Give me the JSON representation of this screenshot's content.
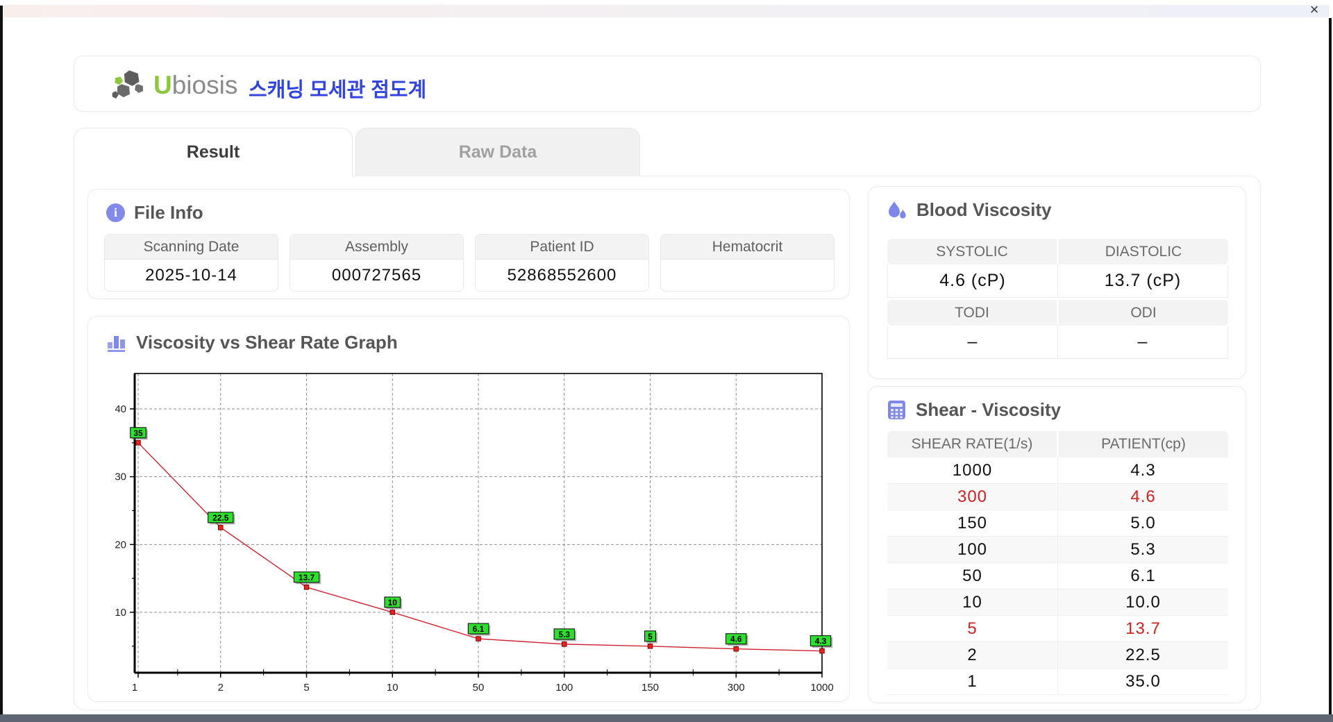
{
  "window": {
    "close_label": "×"
  },
  "header": {
    "logo_u": "U",
    "logo_rest": "biosis",
    "app_title_ko": "스캐닝 모세관 점도계"
  },
  "tabs": [
    {
      "label": "Result",
      "active": true
    },
    {
      "label": "Raw Data",
      "active": false
    }
  ],
  "file_info": {
    "title": "File Info",
    "fields": [
      {
        "label": "Scanning Date",
        "value": "2025-10-14"
      },
      {
        "label": "Assembly",
        "value": "000727565"
      },
      {
        "label": "Patient ID",
        "value": "52868552600"
      },
      {
        "label": "Hematocrit",
        "value": ""
      }
    ]
  },
  "blood_viscosity": {
    "title": "Blood Viscosity",
    "groups": [
      {
        "cells": [
          {
            "label": "SYSTOLIC",
            "value": "4.6 (cP)"
          },
          {
            "label": "DIASTOLIC",
            "value": "13.7 (cP)"
          }
        ]
      },
      {
        "cells": [
          {
            "label": "TODI",
            "value": "–"
          },
          {
            "label": "ODI",
            "value": "–"
          }
        ]
      }
    ]
  },
  "shear_viscosity": {
    "title": "Shear - Viscosity",
    "columns": [
      "SHEAR RATE(1/s)",
      "PATIENT(cp)"
    ],
    "rows": [
      {
        "shear": "1000",
        "patient": "4.3",
        "highlight": false
      },
      {
        "shear": "300",
        "patient": "4.6",
        "highlight": true
      },
      {
        "shear": "150",
        "patient": "5.0",
        "highlight": false
      },
      {
        "shear": "100",
        "patient": "5.3",
        "highlight": false
      },
      {
        "shear": "50",
        "patient": "6.1",
        "highlight": false
      },
      {
        "shear": "10",
        "patient": "10.0",
        "highlight": false
      },
      {
        "shear": "5",
        "patient": "13.7",
        "highlight": true
      },
      {
        "shear": "2",
        "patient": "22.5",
        "highlight": false
      },
      {
        "shear": "1",
        "patient": "35.0",
        "highlight": false
      }
    ],
    "highlight_color": "#cc2222"
  },
  "chart_data": {
    "type": "line",
    "title": "Viscosity vs Shear Rate Graph",
    "xlabel": "",
    "ylabel": "",
    "x": [
      1,
      2,
      5,
      10,
      50,
      100,
      150,
      300,
      1000
    ],
    "values": [
      35,
      22.5,
      13.7,
      10,
      6.1,
      5.3,
      5,
      4.6,
      4.3
    ],
    "point_labels": [
      "35",
      "22.5",
      "13.7",
      "10",
      "6.1",
      "5.3",
      "5",
      "4.6",
      "4.3"
    ],
    "x_tick_labels": [
      "1",
      "2",
      "5",
      "10",
      "50",
      "100",
      "150",
      "300",
      "1000"
    ],
    "y_ticks": [
      10,
      20,
      30,
      40
    ],
    "y_minor_ticks": [
      5,
      15,
      25,
      35
    ],
    "ylim": [
      1.09,
      45.22
    ],
    "x_scale": "even-categorical",
    "grid": "dashed",
    "legend": "none",
    "line_color": "#cc2233",
    "marker_color": "#ee2222",
    "marker_edge": "#7a0000",
    "label_bg": "#2fdf2f",
    "label_border": "#000000"
  }
}
